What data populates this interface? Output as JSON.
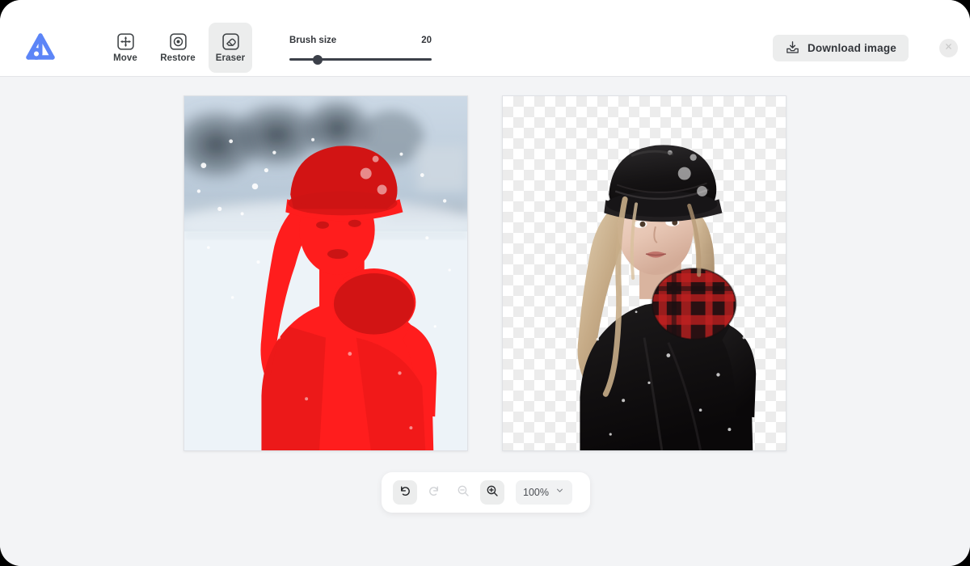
{
  "app": {
    "logo_icon": "aura-a-logo-icon",
    "background_color": "#f3f4f6",
    "header_background": "#ffffff"
  },
  "toolbar": {
    "tools": [
      {
        "id": "move",
        "label": "Move",
        "icon": "move-arrows-icon",
        "active": false
      },
      {
        "id": "restore",
        "label": "Restore",
        "icon": "restore-target-icon",
        "active": false
      },
      {
        "id": "eraser",
        "label": "Eraser",
        "icon": "eraser-icon",
        "active": true
      }
    ],
    "brush": {
      "label": "Brush size",
      "value": "20",
      "slider_percent": 20,
      "min": "1",
      "max": "100"
    },
    "download_label": "Download image",
    "download_icon": "download-tray-icon",
    "close_icon": "close-x-icon"
  },
  "canvas": {
    "left_panel": {
      "name": "original-image-with-mask",
      "mask_color": "#ff1d1d",
      "alt": "Woman in winter coat and hat in snow, red selection mask over subject"
    },
    "right_panel": {
      "name": "result-image-transparent",
      "transparent": true,
      "alt": "Woman in black coat and cap with red plaid scarf, background removed"
    }
  },
  "bottombar": {
    "buttons": [
      {
        "id": "undo",
        "icon": "undo-arrow-icon",
        "enabled": true,
        "active": true
      },
      {
        "id": "redo",
        "icon": "redo-arrow-icon",
        "enabled": false,
        "active": false
      },
      {
        "id": "zoom-out",
        "icon": "zoom-out-icon",
        "enabled": false,
        "active": false
      },
      {
        "id": "zoom-in",
        "icon": "zoom-in-icon",
        "enabled": true,
        "active": true
      }
    ],
    "zoom_level": "100%",
    "zoom_chevron_icon": "chevron-down-icon"
  }
}
